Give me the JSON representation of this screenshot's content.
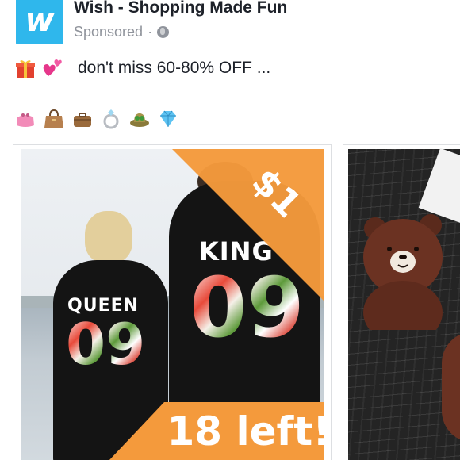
{
  "post": {
    "page_name": "Wish - Shopping Made Fun",
    "sponsored": "Sponsored",
    "separator": "·",
    "text": "don't miss 60-80% OFF ..."
  },
  "avatar": {
    "letter": "w",
    "color": "#2fb7ec"
  },
  "emojis_line": [
    "gift-emoji",
    "two-hearts-emoji"
  ],
  "emoji_row": [
    "purse-emoji",
    "handbag-emoji",
    "briefcase-emoji",
    "ring-emoji",
    "hat-emoji",
    "gem-emoji"
  ],
  "carousel": {
    "cards": [
      {
        "price": "$1",
        "stock": "18 left!",
        "print_left_word": "QUEEN",
        "print_left_num": "09",
        "print_right_word": "KING",
        "print_right_num": "09"
      },
      {
        "image": "bear-phone-case"
      }
    ]
  },
  "colors": {
    "accent": "#f49a3c",
    "meta": "#90949c",
    "brand": "#2fb7ec"
  }
}
